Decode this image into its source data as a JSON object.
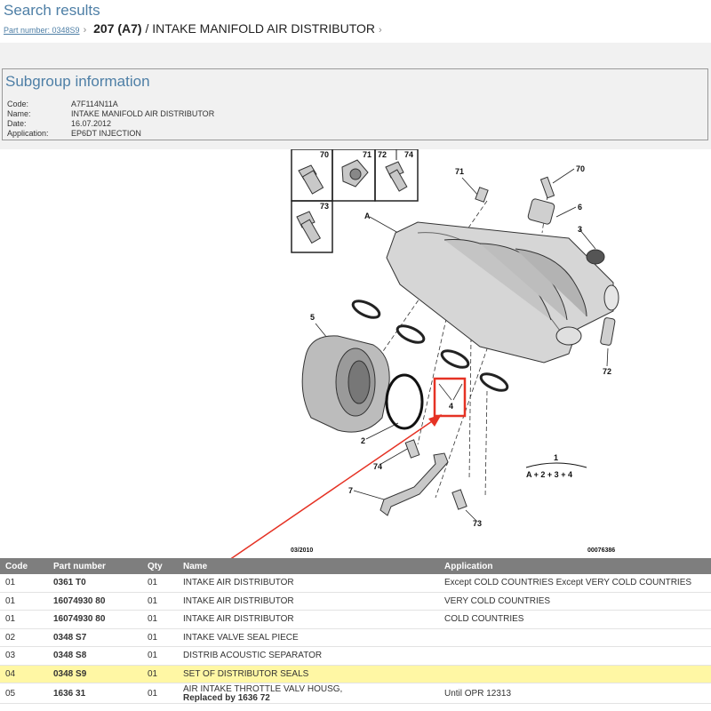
{
  "header": {
    "search_title": "Search results",
    "breadcrumb_link": "Part number: 0348S9",
    "breadcrumb_model": "207 (A7)",
    "breadcrumb_rest": "/ INTAKE MANIFOLD AIR DISTRIBUTOR"
  },
  "subgroup": {
    "title": "Subgroup information",
    "rows": [
      {
        "key": "Code:",
        "value": "A7F114N11A"
      },
      {
        "key": "Name:",
        "value": "INTAKE MANIFOLD AIR DISTRIBUTOR"
      },
      {
        "key": "Date:",
        "value": "16.07.2012"
      },
      {
        "key": "Application:",
        "value": "EP6DT INJECTION"
      }
    ]
  },
  "diagram": {
    "callouts": [
      "70",
      "71",
      "72",
      "74",
      "73",
      "71",
      "70",
      "6",
      "3",
      "A",
      "5",
      "2",
      "4",
      "72",
      "74",
      "7",
      "73",
      "1"
    ],
    "formula": "A + 2 + 3 + 4",
    "footer_left": "03/2010",
    "footer_right": "00076386"
  },
  "table": {
    "headers": [
      "Code",
      "Part number",
      "Qty",
      "Name",
      "Application"
    ],
    "rows": [
      {
        "code": "01",
        "part": "0361 T0",
        "qty": "01",
        "name": "INTAKE AIR DISTRIBUTOR",
        "name2": "",
        "app": "Except COLD COUNTRIES Except VERY COLD COUNTRIES"
      },
      {
        "code": "01",
        "part": "16074930 80",
        "qty": "01",
        "name": "INTAKE AIR DISTRIBUTOR",
        "name2": "",
        "app": "VERY COLD COUNTRIES"
      },
      {
        "code": "01",
        "part": "16074930 80",
        "qty": "01",
        "name": "INTAKE AIR DISTRIBUTOR",
        "name2": "",
        "app": "COLD COUNTRIES"
      },
      {
        "code": "02",
        "part": "0348 S7",
        "qty": "01",
        "name": "INTAKE VALVE SEAL PIECE",
        "name2": "",
        "app": ""
      },
      {
        "code": "03",
        "part": "0348 S8",
        "qty": "01",
        "name": "DISTRIB ACOUSTIC SEPARATOR",
        "name2": "",
        "app": ""
      },
      {
        "code": "04",
        "part": "0348 S9",
        "qty": "01",
        "name": "SET OF DISTRIBUTOR SEALS",
        "name2": "",
        "app": ""
      },
      {
        "code": "05",
        "part": "1636 31",
        "qty": "01",
        "name": "AIR INTAKE THROTTLE VALV HOUSG,",
        "name2": "Replaced by 1636 72",
        "app": "Until OPR 12313"
      }
    ]
  },
  "colors": {
    "accent": "#4e7fa6",
    "highlight": "#fff7a4",
    "header_bg": "#7e7e7e",
    "annotation": "#e53224"
  }
}
